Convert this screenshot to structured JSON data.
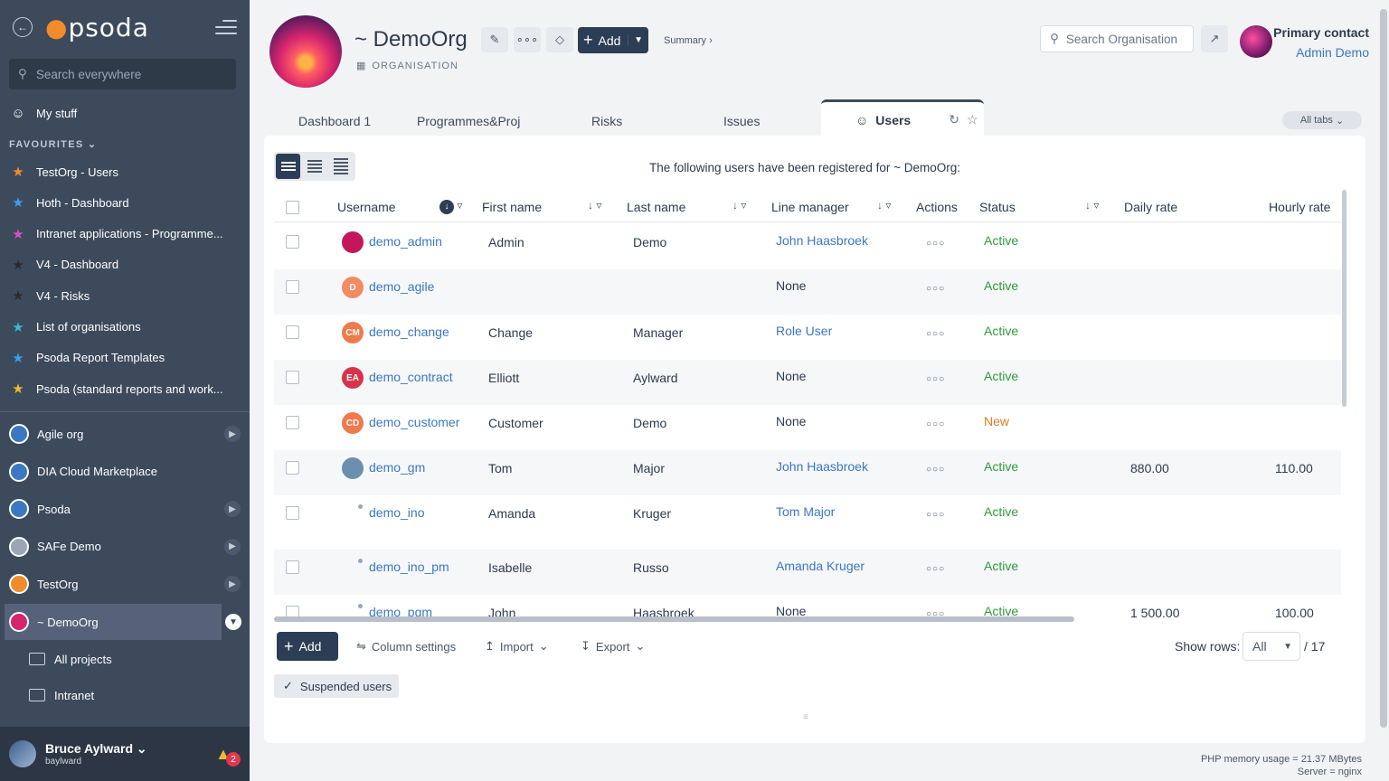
{
  "sidebar": {
    "logo": "psoda",
    "search_placeholder": "Search everywhere",
    "my_stuff": "My stuff",
    "favourites_label": "FAVOURITES",
    "favourites": [
      {
        "label": "TestOrg - Users",
        "color": "#f28b2c"
      },
      {
        "label": "Hoth - Dashboard",
        "color": "#3aa0e8"
      },
      {
        "label": "Intranet applications - Programme...",
        "color": "#d84fc7"
      },
      {
        "label": "V4 - Dashboard",
        "color": "#2b2b2b"
      },
      {
        "label": "V4 - Risks",
        "color": "#2b2b2b"
      },
      {
        "label": "List of organisations",
        "color": "#3ab8d8"
      },
      {
        "label": "Psoda Report Templates",
        "color": "#3aa0e8"
      },
      {
        "label": "Psoda (standard reports and work...",
        "color": "#f2b833"
      }
    ],
    "orgs": [
      {
        "label": "Agile org",
        "arrow": true
      },
      {
        "label": "DIA Cloud Marketplace",
        "arrow": false
      },
      {
        "label": "Psoda",
        "arrow": true
      },
      {
        "label": "SAFe Demo",
        "arrow": true
      },
      {
        "label": "TestOrg",
        "arrow": true
      },
      {
        "label": "~ DemoOrg",
        "arrow": false
      }
    ],
    "subs": [
      "All projects",
      "Intranet"
    ],
    "user": {
      "name": "Bruce Aylward",
      "handle": "baylward",
      "notifications": "2"
    }
  },
  "header": {
    "title": "~ DemoOrg",
    "type_label": "ORGANISATION",
    "add_label": "Add",
    "summary_label": "Summary ›",
    "search_placeholder": "Search Organisation",
    "primary_contact_title": "Primary contact",
    "primary_contact_name": "Admin Demo"
  },
  "tabs": {
    "items": [
      "Dashboard 1",
      "Programmes&Proj",
      "Risks",
      "Issues"
    ],
    "active": "Users",
    "all_tabs": "All tabs"
  },
  "table": {
    "intro": "The following users have been registered for ~ DemoOrg:",
    "columns": [
      "Username",
      "First name",
      "Last name",
      "Line manager",
      "Actions",
      "Status",
      "Daily rate",
      "Hourly rate"
    ],
    "rows": [
      {
        "username": "demo_admin",
        "initials": "",
        "avatar_color": "#c2185b",
        "first": "Admin",
        "last": "Demo",
        "manager": "John Haasbroek",
        "manager_link": true,
        "status": "Active",
        "daily": "",
        "hourly": ""
      },
      {
        "username": "demo_agile",
        "initials": "D",
        "avatar_color": "#f28b63",
        "first": "",
        "last": "",
        "manager": "None",
        "manager_link": false,
        "status": "Active",
        "daily": "",
        "hourly": ""
      },
      {
        "username": "demo_change",
        "initials": "CM",
        "avatar_color": "#f07a4b",
        "first": "Change",
        "last": "Manager",
        "manager": "Role User",
        "manager_link": true,
        "status": "Active",
        "daily": "",
        "hourly": ""
      },
      {
        "username": "demo_contract",
        "initials": "EA",
        "avatar_color": "#d8334a",
        "first": "Elliott",
        "last": "Aylward",
        "manager": "None",
        "manager_link": false,
        "status": "Active",
        "daily": "",
        "hourly": ""
      },
      {
        "username": "demo_customer",
        "initials": "CD",
        "avatar_color": "#f07a4b",
        "first": "Customer",
        "last": "Demo",
        "manager": "None",
        "manager_link": false,
        "status": "New",
        "daily": "",
        "hourly": ""
      },
      {
        "username": "demo_gm",
        "initials": "",
        "avatar_color": "#6b8fb0",
        "first": "Tom",
        "last": "Major",
        "manager": "John Haasbroek",
        "manager_link": true,
        "status": "Active",
        "daily": "880.00",
        "hourly": "110.00"
      },
      {
        "username": "demo_ino",
        "initials": "",
        "avatar_color": "",
        "first": "Amanda",
        "last": "Kruger",
        "manager": "Tom Major",
        "manager_link": true,
        "status": "Active",
        "daily": "",
        "hourly": ""
      },
      {
        "username": "demo_ino_pm",
        "initials": "",
        "avatar_color": "",
        "first": "Isabelle",
        "last": "Russo",
        "manager": "Amanda Kruger",
        "manager_link": true,
        "status": "Active",
        "daily": "",
        "hourly": ""
      },
      {
        "username": "demo_pgm",
        "initials": "",
        "avatar_color": "",
        "first": "John",
        "last": "Haasbroek",
        "manager": "None",
        "manager_link": false,
        "status": "Active",
        "daily": "1 500.00",
        "hourly": "100.00"
      }
    ]
  },
  "footer": {
    "add_label": "Add",
    "column_settings": "Column settings",
    "import_label": "Import",
    "export_label": "Export",
    "show_rows_label": "Show rows:",
    "show_rows_value": "All",
    "total": "/ 17",
    "suspended_label": "Suspended users"
  },
  "server": {
    "php": "PHP memory usage = 21.37 MBytes",
    "server": "Server = nginx"
  }
}
